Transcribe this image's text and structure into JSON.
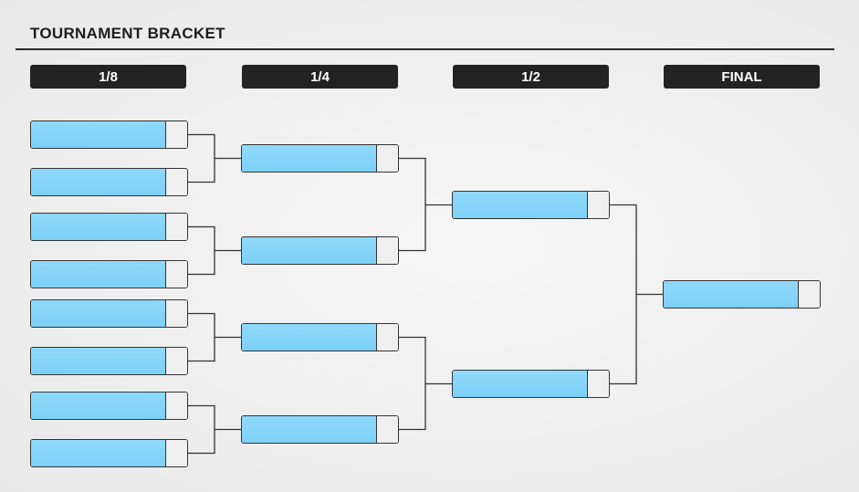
{
  "title": "TOURNAMENT BRACKET",
  "rounds": [
    {
      "label": "1/8",
      "slots": 8
    },
    {
      "label": "1/4",
      "slots": 4
    },
    {
      "label": "1/2",
      "slots": 2
    },
    {
      "label": "FINAL",
      "slots": 1
    }
  ],
  "colors": {
    "slot_name": "#7dd0f8",
    "slot_score": "#efefef",
    "header_bg": "#232323",
    "line": "#333333"
  }
}
